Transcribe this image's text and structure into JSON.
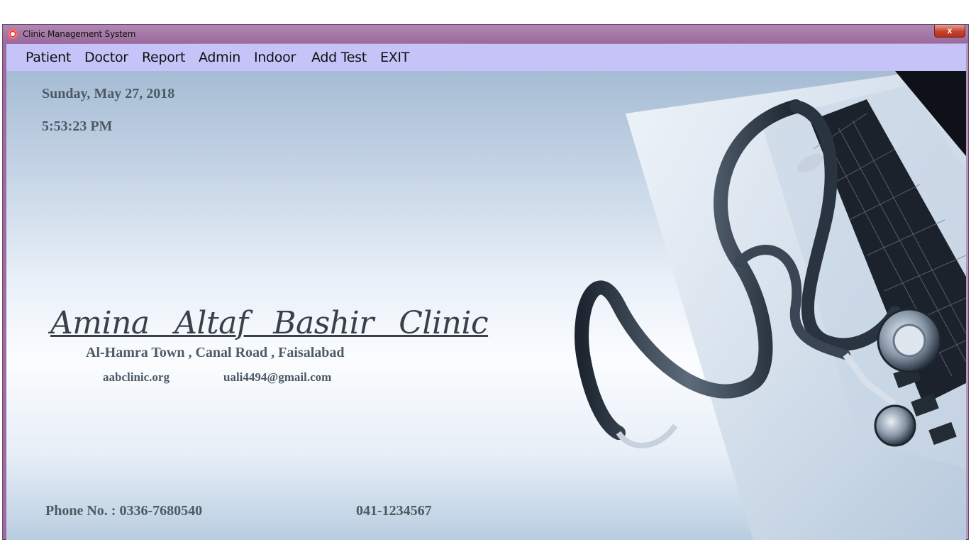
{
  "window": {
    "title": "Clinic Management System",
    "close_label": "x",
    "icon": "app-icon"
  },
  "menu": {
    "items": [
      "Patient",
      "Doctor",
      "Report",
      "Admin",
      "Indoor",
      "Add Test",
      "EXIT"
    ]
  },
  "main": {
    "date": "Sunday, May 27, 2018",
    "time": "5:53:23 PM",
    "clinic_name": "Amina Altaf Bashir Clinic",
    "address": "Al-Hamra Town , Canal Road , Faisalabad",
    "website": "aabclinic.org",
    "email": "uali4494@gmail.com",
    "phone_primary": "Phone No. : 0336-7680540",
    "phone_secondary": "041-1234567",
    "hero_image": "stethoscope-on-laptop"
  },
  "colors": {
    "menubar": "#c5c3f8",
    "titlebar": "#9e6aa0",
    "text": "#4d5a66"
  }
}
